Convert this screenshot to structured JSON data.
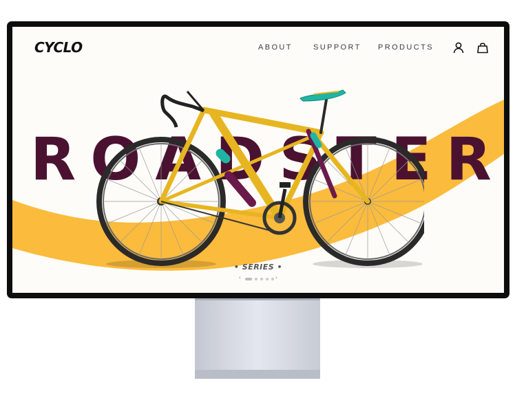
{
  "brand": {
    "logo": "CYCLO"
  },
  "nav": {
    "about": "ABOUT",
    "support": "SUPPORT",
    "products": "PRODUCTS"
  },
  "icons": {
    "account": "user-icon",
    "cart": "shopping-bag-icon"
  },
  "hero": {
    "letters": [
      "R",
      "O",
      "A",
      "D",
      "S",
      "T",
      "E",
      "R"
    ]
  },
  "series": {
    "label": "• SERIES •"
  },
  "carousel": {
    "prev": "‹",
    "next": "›",
    "slides": 5,
    "active_index": 0
  },
  "colors": {
    "accent_yellow": "#fbbb3c",
    "hero_text": "#4a1230",
    "frame_yellow": "#e7b521",
    "teal": "#1fb5a4",
    "background": "#fdfcf8"
  }
}
